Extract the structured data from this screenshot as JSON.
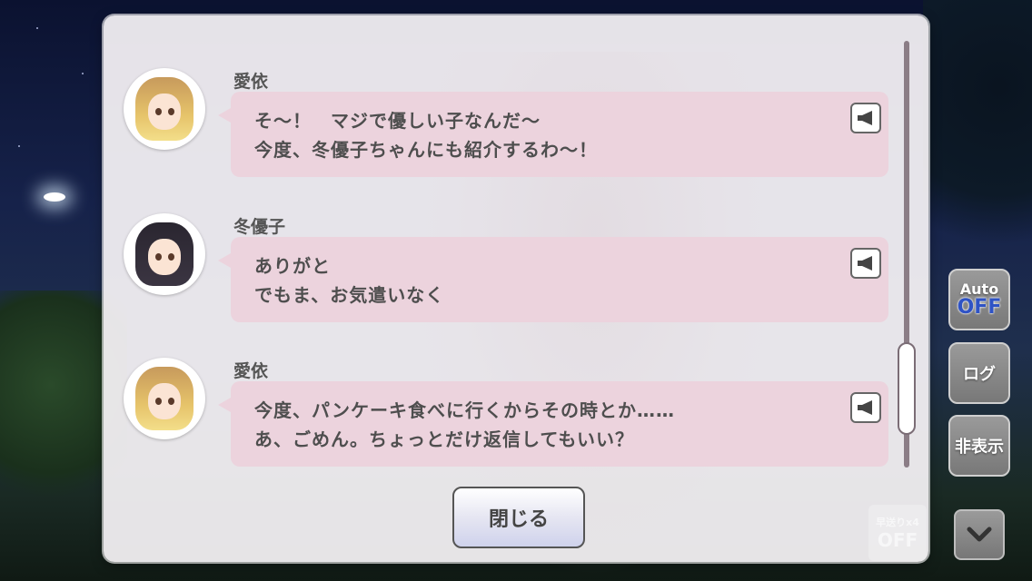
{
  "log": {
    "messages": [
      {
        "speaker": "愛依",
        "line1": "そ～！　マジで優しい子なんだ～",
        "line2": "今度、冬優子ちゃんにも紹介するわ～！",
        "avatar": "blonde"
      },
      {
        "speaker": "冬優子",
        "line1": "ありがと",
        "line2": "でもま、お気遣いなく",
        "avatar": "black"
      },
      {
        "speaker": "愛依",
        "line1": "今度、パンケーキ食べに行くからその時とか……",
        "line2": "あ、ごめん。ちょっとだけ返信してもいい？",
        "avatar": "blonde"
      }
    ],
    "close_label": "閉じる"
  },
  "side": {
    "auto_label": "Auto",
    "auto_state": "OFF",
    "log_label": "ログ",
    "hide_label": "非表示",
    "speed_label": "早送りx4",
    "speed_state": "OFF"
  },
  "colors": {
    "bubble": "#ecd3dd",
    "panel": "#f6f3f6",
    "auto_off": "#2f53c5"
  }
}
